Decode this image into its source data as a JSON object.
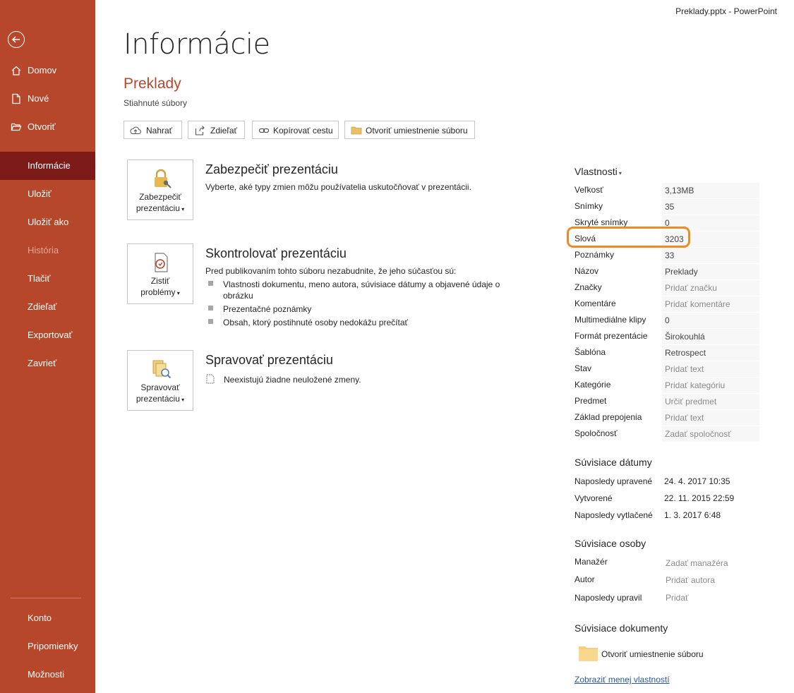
{
  "window_title": "Preklady.pptx  -  PowerPoint",
  "sidebar": {
    "items": [
      {
        "label": "Domov",
        "icon": "home-icon"
      },
      {
        "label": "Nové",
        "icon": "new-document-icon"
      },
      {
        "label": "Otvoriť",
        "icon": "folder-open-icon"
      },
      {
        "label": "Informácie"
      },
      {
        "label": "Uložiť"
      },
      {
        "label": "Uložiť ako"
      },
      {
        "label": "História"
      },
      {
        "label": "Tlačiť"
      },
      {
        "label": "Zdieľať"
      },
      {
        "label": "Exportovať"
      },
      {
        "label": "Zavrieť"
      }
    ],
    "bottom": [
      {
        "label": "Konto"
      },
      {
        "label": "Pripomienky"
      },
      {
        "label": "Možnosti"
      }
    ]
  },
  "main": {
    "title": "Informácie",
    "file_name": "Preklady",
    "file_path": "Stiahnuté súbory",
    "toolbar": {
      "upload": "Nahrať",
      "share": "Zdieľať",
      "copy_path": "Kopírovať cestu",
      "open_location": "Otvoriť umiestnenie súboru"
    },
    "protect": {
      "tile": [
        "Zabezpečiť",
        "prezentáciu"
      ],
      "title": "Zabezpečiť prezentáciu",
      "text": "Vyberte, aké typy zmien môžu používatelia uskutočňovať v prezentácii."
    },
    "inspect": {
      "tile": [
        "Zistiť",
        "problémy"
      ],
      "title": "Skontrolovať prezentáciu",
      "text": "Pred publikovaním tohto súboru nezabudnite, že jeho súčasťou sú:",
      "bullets": [
        "Vlastnosti dokumentu, meno autora, súvisiace dátumy a objavené údaje o obrázku",
        "Prezentačné poznámky",
        "Obsah, ktorý postihnuté osoby nedokážu prečítať"
      ]
    },
    "manage": {
      "tile": [
        "Spravovať",
        "prezentáciu"
      ],
      "title": "Spravovať prezentáciu",
      "text": "Neexistujú žiadne neuložené zmeny."
    }
  },
  "properties": {
    "heading": "Vlastnosti",
    "rows": [
      {
        "key": "Veľkosť",
        "value": "3,13MB",
        "placeholder": false
      },
      {
        "key": "Snímky",
        "value": "35",
        "placeholder": false
      },
      {
        "key": "Skryté snímky",
        "value": "0",
        "placeholder": false
      },
      {
        "key": "Slová",
        "value": "3203",
        "placeholder": false
      },
      {
        "key": "Poznámky",
        "value": "33",
        "placeholder": false
      },
      {
        "key": "Názov",
        "value": "Preklady",
        "placeholder": false
      },
      {
        "key": "Značky",
        "value": "Pridať značku",
        "placeholder": true
      },
      {
        "key": "Komentáre",
        "value": "Pridať komentáre",
        "placeholder": true
      },
      {
        "key": "Multimediálne klipy",
        "value": "0",
        "placeholder": false
      },
      {
        "key": "Formát prezentácie",
        "value": "Širokouhlá",
        "placeholder": false
      },
      {
        "key": "Šablóna",
        "value": "Retrospect",
        "placeholder": false
      },
      {
        "key": "Stav",
        "value": "Pridať text",
        "placeholder": true
      },
      {
        "key": "Kategórie",
        "value": "Pridať kategóriu",
        "placeholder": true
      },
      {
        "key": "Predmet",
        "value": "Určiť predmet",
        "placeholder": true
      },
      {
        "key": "Základ prepojenia",
        "value": "Pridať text",
        "placeholder": true
      },
      {
        "key": "Spoločnosť",
        "value": "Zadať spoločnosť",
        "placeholder": true
      }
    ],
    "dates": {
      "heading": "Súvisiace dátumy",
      "rows": [
        {
          "key": "Naposledy upravené",
          "value": "24. 4. 2017 10:35"
        },
        {
          "key": "Vytvorené",
          "value": "22. 11. 2015 22:59"
        },
        {
          "key": "Naposledy vytlačené",
          "value": "1. 3. 2017 6:48"
        }
      ]
    },
    "people": {
      "heading": "Súvisiace osoby",
      "rows": [
        {
          "key": "Manažér",
          "value": "Zadať manažéra"
        },
        {
          "key": "Autor",
          "value": "Pridať autora"
        },
        {
          "key": "Naposledy upravil",
          "value": "Pridať"
        }
      ]
    },
    "documents": {
      "heading": "Súvisiace dokumenty",
      "open_location": "Otvoriť umiestnenie súboru"
    },
    "show_less": "Zobraziť menej vlastností"
  },
  "colors": {
    "sidebar": "#b7472a",
    "sidebar_active": "#7d1b19",
    "accent_text": "#b7472a",
    "highlight": "#f08a24"
  }
}
